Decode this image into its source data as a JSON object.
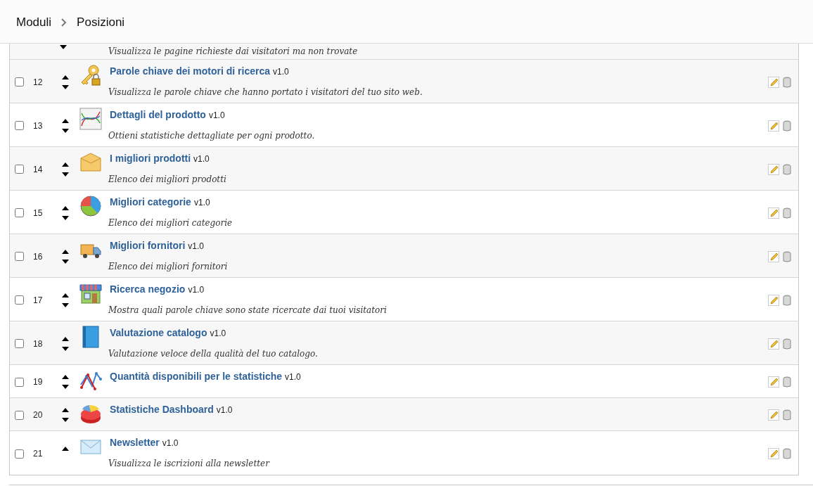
{
  "breadcrumb": {
    "parent": "Moduli",
    "current": "Posizioni"
  },
  "partial_row": {
    "move_down": true,
    "description": "Visualizza le pagine richieste dai visitatori ma non trovate"
  },
  "rows": [
    {
      "kind": "key",
      "number": "12",
      "checked": false,
      "move_up": true,
      "move_down": true,
      "name": "Parole chiave dei motori di ricerca",
      "version": "v1.0",
      "description": "Visualizza le parole chiave che hanno portato i visitatori del tuo sito web."
    },
    {
      "kind": "curves",
      "number": "13",
      "checked": false,
      "move_up": true,
      "move_down": true,
      "name": "Dettagli del prodotto",
      "version": "v1.0",
      "description": "Ottieni statistiche dettagliate per ogni prodotto."
    },
    {
      "kind": "box",
      "number": "14",
      "checked": false,
      "move_up": true,
      "move_down": true,
      "name": "I migliori prodotti",
      "version": "v1.0",
      "description": "Elenco dei migliori prodotti"
    },
    {
      "kind": "pie",
      "number": "15",
      "checked": false,
      "move_up": true,
      "move_down": true,
      "name": "Migliori categorie",
      "version": "v1.0",
      "description": "Elenco dei migliori categorie"
    },
    {
      "kind": "truck",
      "number": "16",
      "checked": false,
      "move_up": true,
      "move_down": true,
      "name": "Migliori fornitori",
      "version": "v1.0",
      "description": "Elenco dei migliori fornitori"
    },
    {
      "kind": "store",
      "number": "17",
      "checked": false,
      "move_up": true,
      "move_down": true,
      "name": "Ricerca negozio",
      "version": "v1.0",
      "description": "Mostra quali parole chiave sono state ricercate dai tuoi visitatori"
    },
    {
      "kind": "book",
      "number": "18",
      "checked": false,
      "move_up": true,
      "move_down": true,
      "name": "Valutazione catalogo",
      "version": "v1.0",
      "description": "Valutazione veloce della qualità del tuo catalogo."
    },
    {
      "kind": "linechart",
      "number": "19",
      "checked": false,
      "move_up": true,
      "move_down": true,
      "name": "Quantità disponibili per le statistiche",
      "version": "v1.0"
    },
    {
      "kind": "pie3d",
      "number": "20",
      "checked": false,
      "move_up": true,
      "move_down": true,
      "name": "Statistiche Dashboard",
      "version": "v1.0"
    },
    {
      "kind": "envelope",
      "number": "21",
      "checked": false,
      "move_up": true,
      "move_down": false,
      "name": "Newsletter",
      "version": "v1.0",
      "description": "Visualizza le iscrizioni alla newsletter"
    }
  ]
}
